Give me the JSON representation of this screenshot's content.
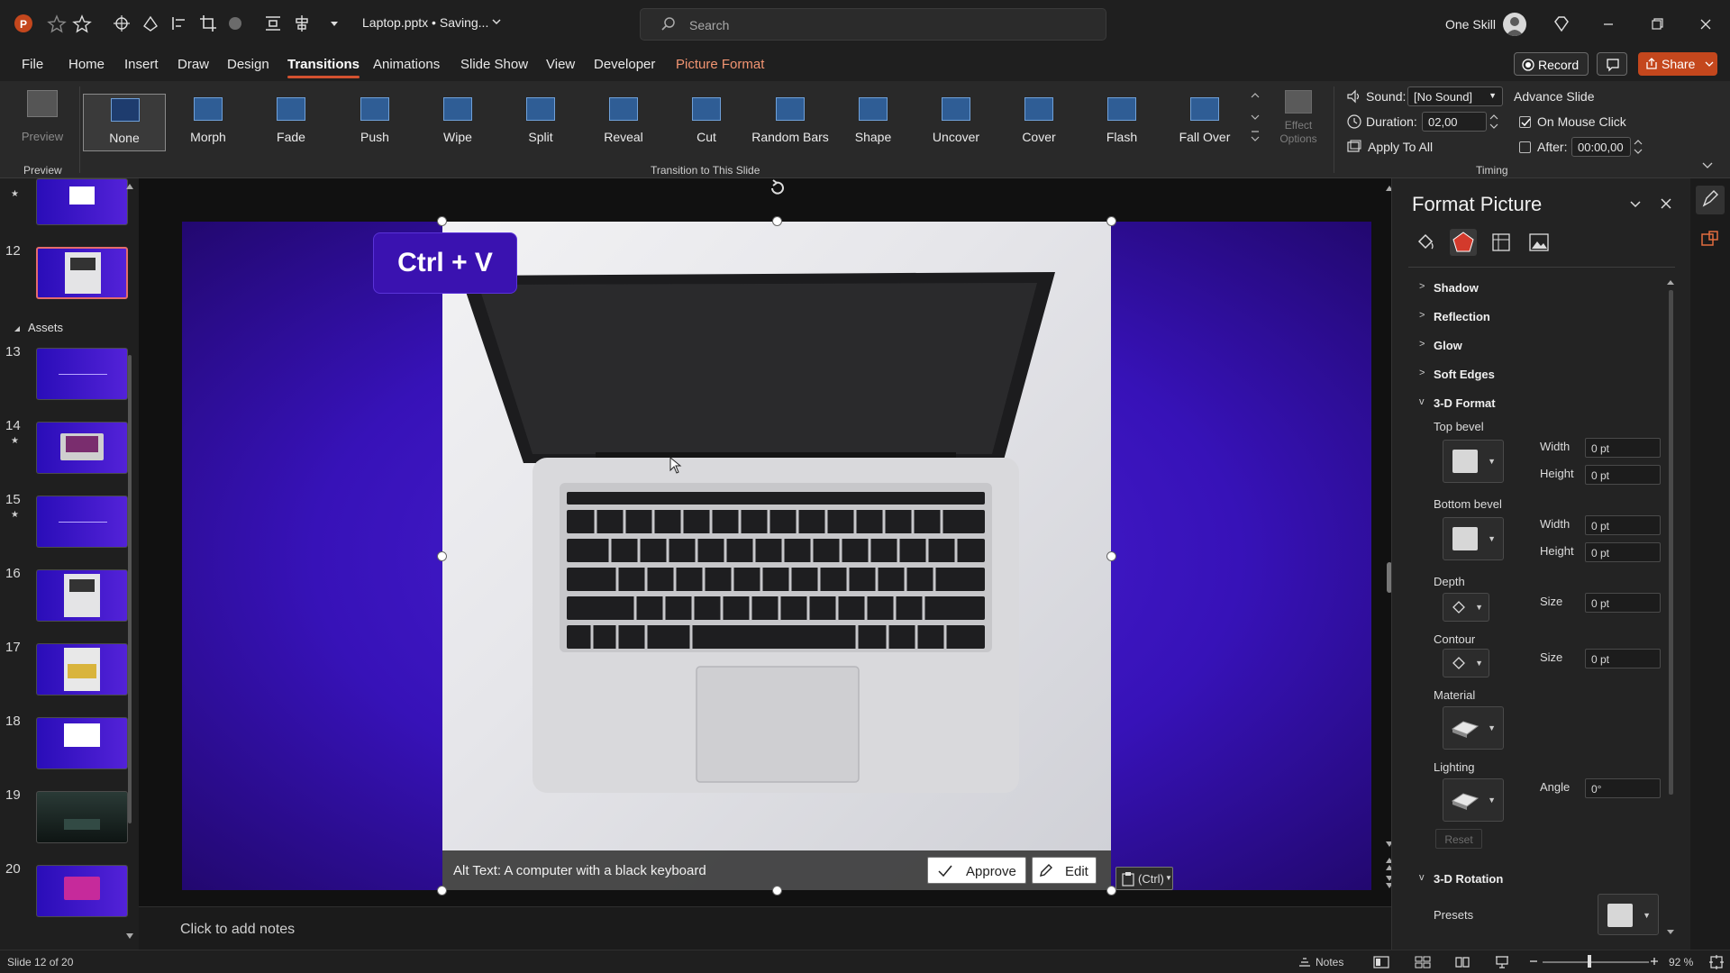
{
  "title_bar": {
    "filename": "Laptop.pptx • Saving...",
    "search_placeholder": "Search",
    "user_name": "One Skill"
  },
  "tabs": [
    "File",
    "Home",
    "Insert",
    "Draw",
    "Design",
    "Transitions",
    "Animations",
    "Slide Show",
    "View",
    "Developer",
    "Picture Format"
  ],
  "active_tab": "Transitions",
  "actions": {
    "record": "Record",
    "share": "Share"
  },
  "ribbon": {
    "preview_label": "Preview",
    "preview_group": "Preview",
    "transitions": [
      "None",
      "Morph",
      "Fade",
      "Push",
      "Wipe",
      "Split",
      "Reveal",
      "Cut",
      "Random Bars",
      "Shape",
      "Uncover",
      "Cover",
      "Flash",
      "Fall Over"
    ],
    "selected_transition": "None",
    "effect_options": "Effect Options",
    "gallery_group": "Transition to This Slide",
    "timing": {
      "sound_label": "Sound:",
      "sound_value": "[No Sound]",
      "duration_label": "Duration:",
      "duration_value": "02,00",
      "apply_all": "Apply To All",
      "advance_label": "Advance Slide",
      "on_mouse_click": "On Mouse Click",
      "after_label": "After:",
      "after_value": "00:00,00",
      "group": "Timing"
    }
  },
  "slides": {
    "section": "Assets",
    "numbers": [
      "12",
      "13",
      "14",
      "15",
      "16",
      "17",
      "18",
      "19",
      "20"
    ],
    "selected": "12"
  },
  "slide": {
    "callout": "Ctrl + V",
    "alt_text": "Alt Text: A computer with a black keyboard",
    "approve": "Approve",
    "edit": "Edit",
    "paste_option": "(Ctrl)"
  },
  "notes_placeholder": "Click to add notes",
  "pane": {
    "title": "Format Picture",
    "sections": [
      "Shadow",
      "Reflection",
      "Glow",
      "Soft Edges",
      "3-D Format",
      "3-D Rotation"
    ],
    "top_bevel": "Top bevel",
    "bottom_bevel": "Bottom bevel",
    "width_label": "Width",
    "height_label": "Height",
    "depth": "Depth",
    "contour": "Contour",
    "size_label": "Size",
    "material": "Material",
    "lighting": "Lighting",
    "angle_label": "Angle",
    "angle_value": "0°",
    "pt_value": "0 pt",
    "reset": "Reset",
    "presets": "Presets"
  },
  "status": {
    "slide_count": "Slide 12 of 20",
    "notes": "Notes",
    "zoom": "92 %"
  },
  "colors": {
    "accent": "#d35230",
    "slide_bg": "#3712b8",
    "share": "#c4471d"
  }
}
